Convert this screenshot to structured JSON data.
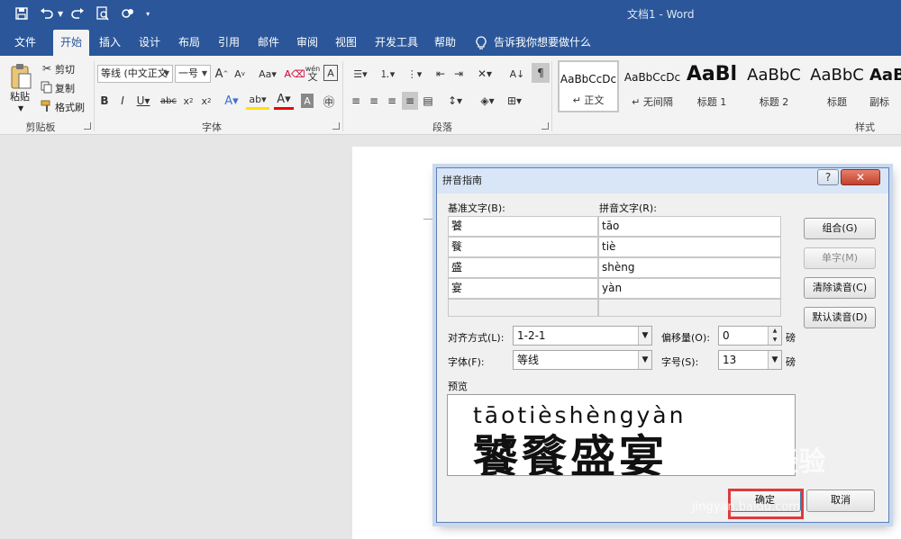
{
  "titlebar": {
    "doc_title": "文档1 - Word"
  },
  "tabs": [
    {
      "label": "文件"
    },
    {
      "label": "开始"
    },
    {
      "label": "插入"
    },
    {
      "label": "设计"
    },
    {
      "label": "布局"
    },
    {
      "label": "引用"
    },
    {
      "label": "邮件"
    },
    {
      "label": "审阅"
    },
    {
      "label": "视图"
    },
    {
      "label": "开发工具"
    },
    {
      "label": "帮助"
    }
  ],
  "tell_me": "告诉我你想要做什么",
  "clipboard": {
    "paste": "粘贴",
    "cut": "剪切",
    "copy": "复制",
    "format_painter": "格式刷",
    "group": "剪贴板"
  },
  "font": {
    "font_name": "等线 (中文正文",
    "font_size": "一号",
    "group": "字体"
  },
  "paragraph": {
    "group": "段落"
  },
  "styles": {
    "group": "样式",
    "items": [
      {
        "sample": "AaBbCcDc",
        "name": "↵ 正文"
      },
      {
        "sample": "AaBbCcDc",
        "name": "↵ 无间隔"
      },
      {
        "sample": "AaBl",
        "name": "标题 1"
      },
      {
        "sample": "AaBbC",
        "name": "标题 2"
      },
      {
        "sample": "AaBbC",
        "name": "标题"
      },
      {
        "sample": "AaBl",
        "name": "副标"
      }
    ]
  },
  "dialog": {
    "title": "拼音指南",
    "base_label": "基准文字(B):",
    "ruby_label": "拼音文字(R):",
    "rows": [
      {
        "base": "饕",
        "ruby": "tāo"
      },
      {
        "base": "餮",
        "ruby": "tiè"
      },
      {
        "base": "盛",
        "ruby": "shèng"
      },
      {
        "base": "宴",
        "ruby": "yàn"
      }
    ],
    "buttons": {
      "group": "组合(G)",
      "mono": "单字(M)",
      "clear": "清除读音(C)",
      "default": "默认读音(D)",
      "ok": "确定",
      "cancel": "取消"
    },
    "alignment_label": "对齐方式(L):",
    "alignment_value": "1-2-1",
    "offset_label": "偏移量(O):",
    "offset_value": "0",
    "offset_unit": "磅",
    "font_label": "字体(F):",
    "font_value": "等线",
    "size_label": "字号(S):",
    "size_value": "13",
    "size_unit": "磅",
    "preview_label": "预览",
    "preview_pinyin": "tāotièshèngyàn",
    "preview_base": "饕餮盛宴"
  },
  "watermark": {
    "logo": "Baidu经验",
    "url": "jingyan.baidu.com"
  }
}
